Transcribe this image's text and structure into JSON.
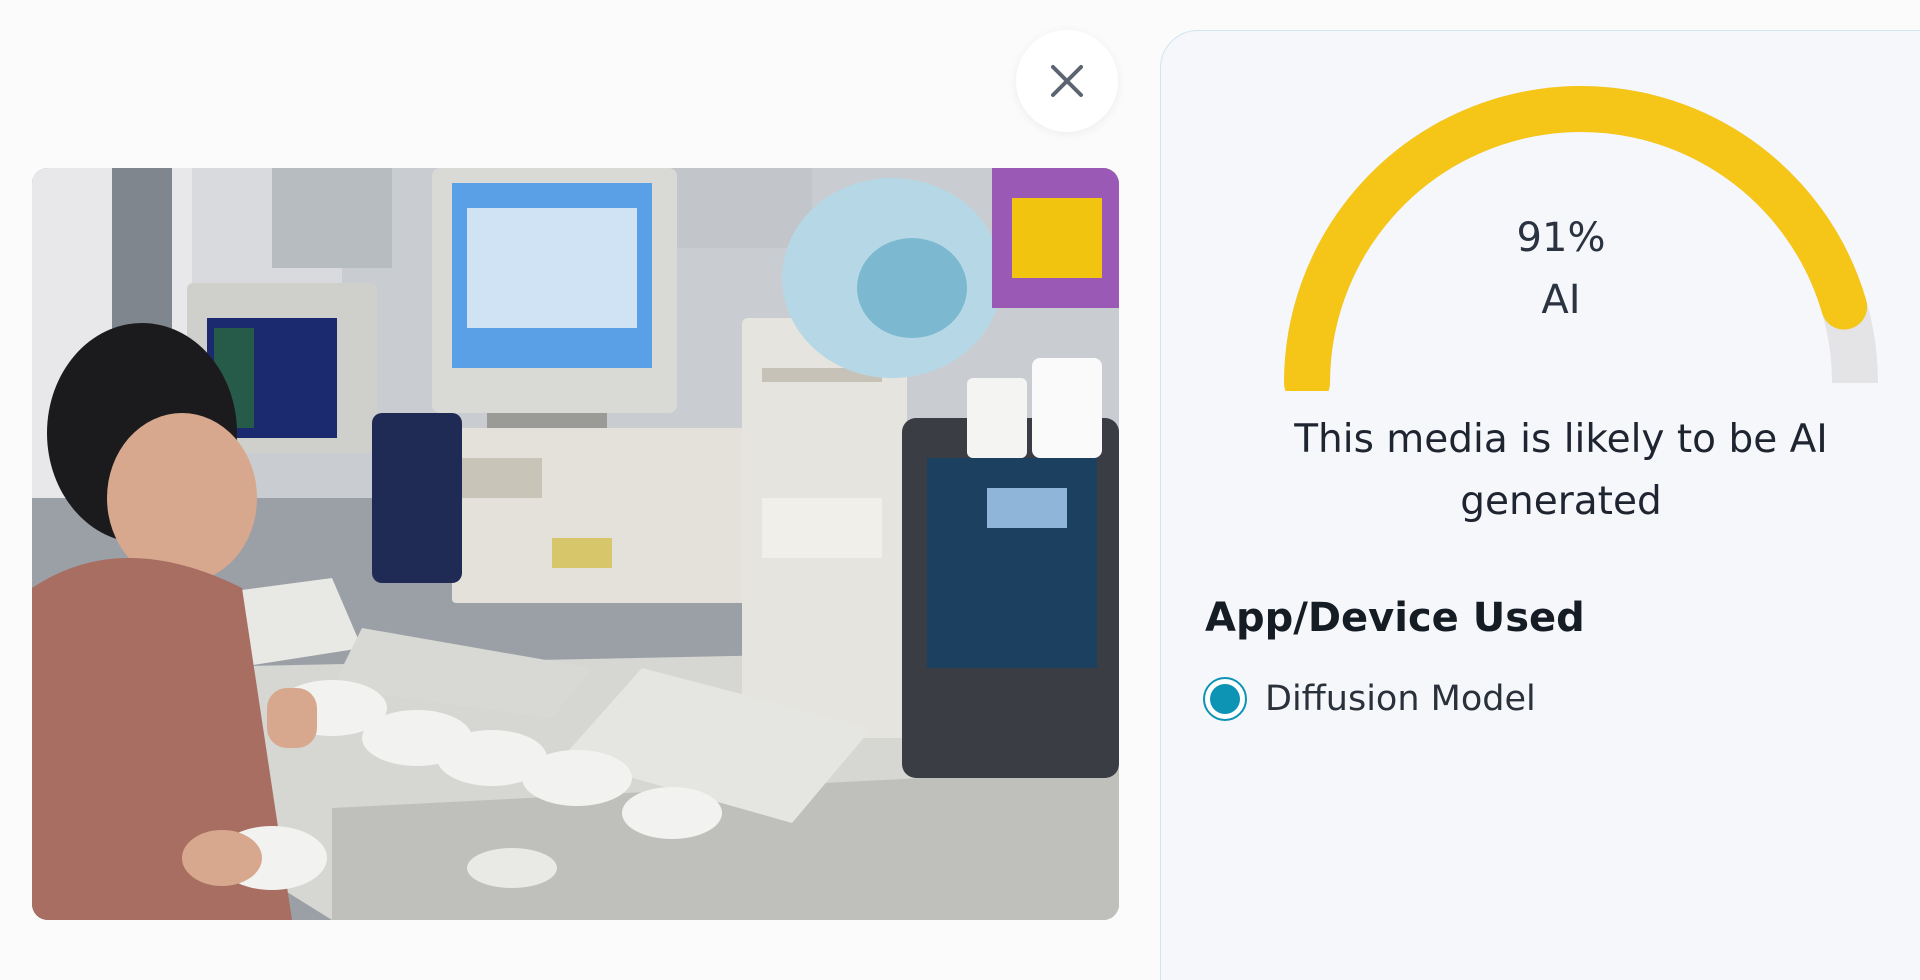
{
  "close": {
    "icon": "close-icon"
  },
  "preview": {
    "subject": "photo",
    "icon": "photo-preview"
  },
  "result": {
    "percent_value": 91,
    "percent_label": "91%",
    "class_label": "AI",
    "verdict": "This media is likely to be AI generated",
    "gauge_color": "#f5c518",
    "gauge_track_color": "#e4e4e7"
  },
  "section": {
    "title": "App/Device Used",
    "options": [
      {
        "label": "Diffusion Model",
        "selected": true
      }
    ]
  },
  "colors": {
    "accent": "#0d93b4",
    "panel_bg": "#f5f7fb",
    "panel_border": "#cfe6ee"
  }
}
